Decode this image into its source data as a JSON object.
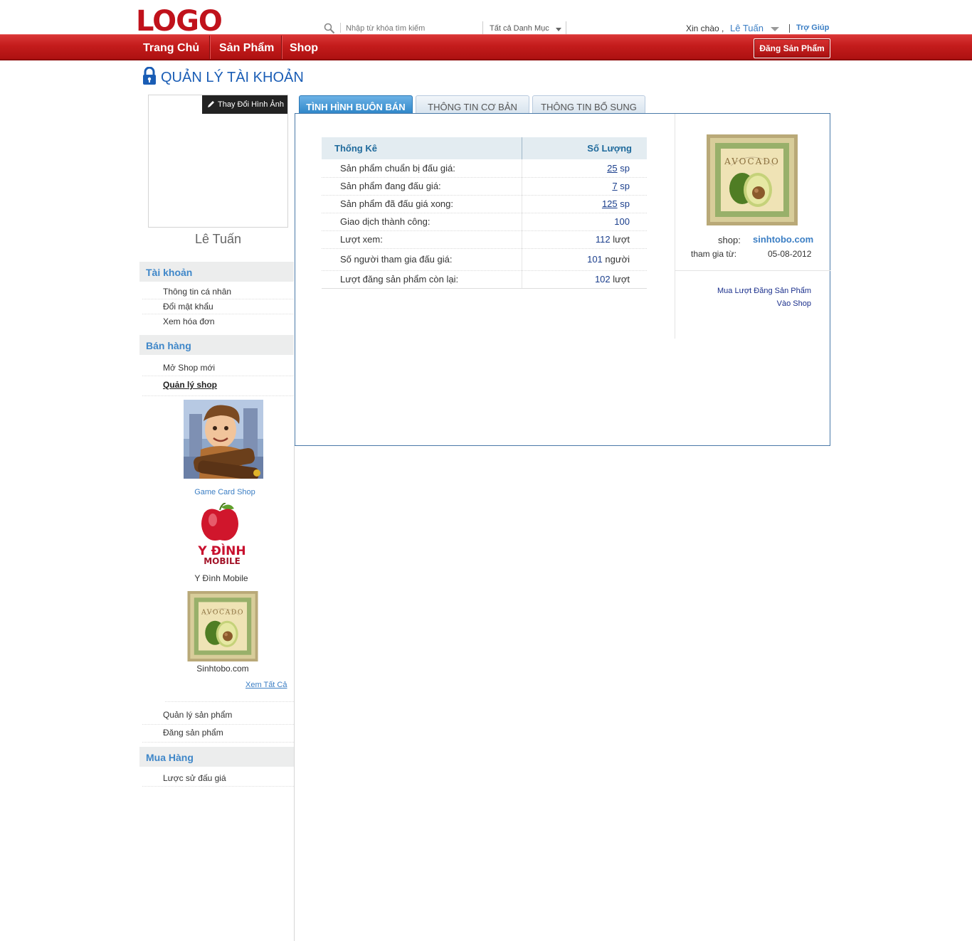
{
  "header": {
    "logo": "LOGO",
    "search_placeholder": "Nhập từ khóa tìm kiếm",
    "category": "Tất cả Danh Mục",
    "greeting": "Xin chào ,",
    "user_name": "Lê Tuấn",
    "help": "Trợ Giúp"
  },
  "nav": {
    "items": [
      "Trang Chủ",
      "Sản Phẩm",
      "Shop"
    ],
    "post_button": "Đăng Sản Phẩm"
  },
  "page_title": "QUẢN LÝ TÀI KHOẢN",
  "profile": {
    "change_photo": "Thay Đổi Hình Ảnh",
    "name": "Lê Tuấn"
  },
  "sidebar": {
    "account": {
      "title": "Tài khoản",
      "items": [
        "Thông tin cá nhân",
        "Đổi mật khẩu",
        "Xem hóa đơn"
      ]
    },
    "selling": {
      "title": "Bán hàng",
      "items": [
        "Mở Shop mới",
        "Quản lý shop"
      ],
      "shops": [
        "Game Card Shop",
        "Y Đình Mobile",
        "Sinhtobo.com"
      ],
      "see_all": "Xem Tất Cả",
      "items2": [
        "Quản lý sản phẩm",
        "Đăng sản phẩm"
      ]
    },
    "buying": {
      "title": "Mua Hàng",
      "items": [
        "Lược sử đấu giá"
      ]
    },
    "ydinh_logo": {
      "line1": "Y ĐÌNH",
      "line2": "MOBILE"
    }
  },
  "tabs": [
    "TÌNH HÌNH BUÔN BÁN",
    "THÔNG TIN CƠ BẢN",
    "THÔNG TIN BỔ SUNG"
  ],
  "stats": {
    "col1": "Thống Kê",
    "col2": "Số Lượng",
    "rows": [
      {
        "label": "Sản phẩm chuẩn bị đấu giá:",
        "value": "25",
        "unit": "sp"
      },
      {
        "label": "Sản phẩm đang đấu giá:",
        "value": "7",
        "unit": "sp"
      },
      {
        "label": "Sản phẩm đã đấu giá xong:",
        "value": "125",
        "unit": "sp"
      },
      {
        "label": "Giao dịch thành công:",
        "value": "100",
        "unit": ""
      },
      {
        "label": "Lượt xem:",
        "value": "112",
        "unit": "lượt"
      },
      {
        "label": "Số người tham gia đấu giá:",
        "value": "101",
        "unit": "người"
      },
      {
        "label": "Lượt đăng sản phẩm còn lại:",
        "value": "102",
        "unit": "lượt"
      }
    ]
  },
  "shop_info": {
    "shop_label": "shop:",
    "shop_name": "sinhtobo.com",
    "join_label": "tham gia từ:",
    "join_date": "05-08-2012",
    "buy_line1": "Mua Lượt Đăng Sản Phẩm",
    "buy_line2": "Vào Shop",
    "logo_text": "AVOCADO"
  },
  "colors": {
    "brand_red": "#c41c1c",
    "link_blue": "#3b7ec4",
    "tab_active": "#2e86c8"
  }
}
